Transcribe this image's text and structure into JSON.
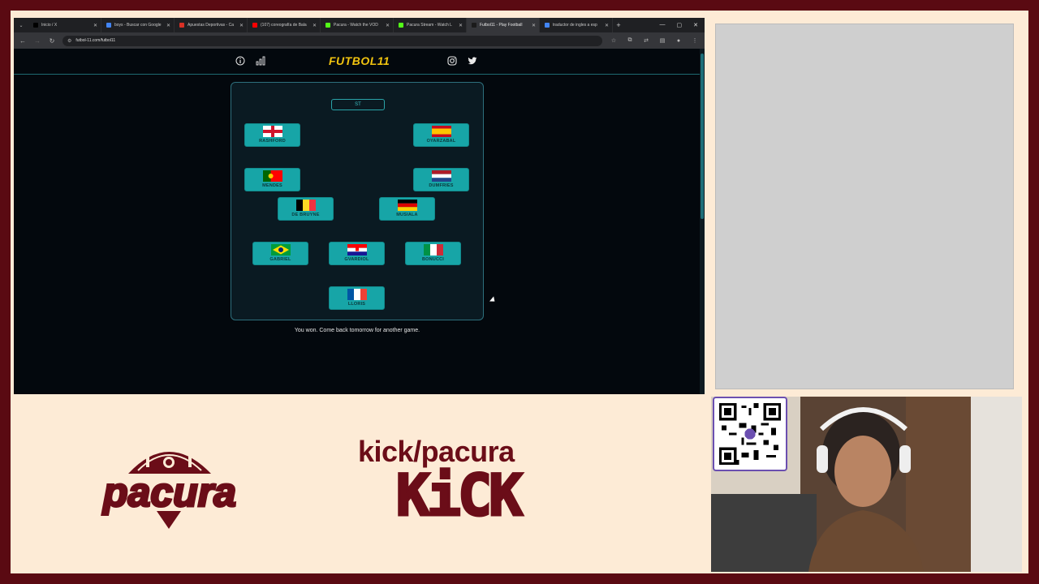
{
  "browser": {
    "tabs": [
      {
        "title": "Inicio / X",
        "favicon_color": "#000000"
      },
      {
        "title": "boys - Buscar con Google",
        "favicon_color": "#4285f4"
      },
      {
        "title": "Apuestas Deportivas - Ca",
        "favicon_color": "#d93025"
      },
      {
        "title": "(107) coreografía de Bala",
        "favicon_color": "#ff0000"
      },
      {
        "title": "Pacura - Watch the VOD",
        "favicon_color": "#53fc18"
      },
      {
        "title": "Pacura Stream - Watch L",
        "favicon_color": "#53fc18"
      },
      {
        "title": "Futbol11 - Play Football",
        "favicon_color": "#1b1b1b",
        "active": true
      },
      {
        "title": "traductor de ingles a esp",
        "favicon_color": "#4285f4"
      }
    ],
    "url": "futbol-11.com/futbol11"
  },
  "site": {
    "logo_text": "FUTBOL11",
    "icons": [
      "info-icon",
      "stats-icon",
      "instagram-icon",
      "twitter-icon"
    ],
    "empty_slot_label": "ST",
    "players": [
      {
        "name": "RASHFORD",
        "country": "england"
      },
      {
        "name": "OYARZABAL",
        "country": "spain"
      },
      {
        "name": "MENDES",
        "country": "portugal"
      },
      {
        "name": "DUMFRIES",
        "country": "netherlands"
      },
      {
        "name": "DE BRUYNE",
        "country": "belgium"
      },
      {
        "name": "MUSIALA",
        "country": "germany"
      },
      {
        "name": "GABRIEL",
        "country": "brazil"
      },
      {
        "name": "GVARDIOL",
        "country": "croatia"
      },
      {
        "name": "BONUCCI",
        "country": "italy"
      },
      {
        "name": "LLORIS",
        "country": "france"
      }
    ],
    "result_message": "You won. Come back tomorrow for another game."
  },
  "overlay": {
    "brand_name": "pacura",
    "kick_handle": "kick/pacura",
    "kick_logo": "KiCK",
    "brand_color": "#6b0d18"
  }
}
